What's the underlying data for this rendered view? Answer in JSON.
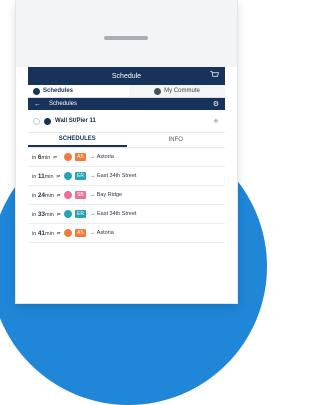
{
  "header": {
    "title": "Schedule"
  },
  "segments": [
    {
      "label": "Schedules"
    },
    {
      "label": "My Commute"
    }
  ],
  "subbar": {
    "title": "Schedules"
  },
  "stop": {
    "name": "Wall St/Pier 11"
  },
  "tabs": [
    {
      "label": "SCHEDULES"
    },
    {
      "label": "INFO"
    }
  ],
  "rows": [
    {
      "prefix": "in",
      "num": "6",
      "unit": "min",
      "route": "AS",
      "color": "#f37a3c",
      "dest": "Astoria"
    },
    {
      "prefix": "in",
      "num": "11",
      "unit": "min",
      "route": "ER",
      "color": "#27a2b7",
      "dest": "East 34th Street"
    },
    {
      "prefix": "in",
      "num": "24",
      "unit": "min",
      "route": "SB",
      "color": "#ec6e99",
      "dest": "Bay Ridge"
    },
    {
      "prefix": "in",
      "num": "33",
      "unit": "min",
      "route": "ER",
      "color": "#27a2b7",
      "dest": "East 34th Street"
    },
    {
      "prefix": "in",
      "num": "41",
      "unit": "min",
      "route": "AS",
      "color": "#f37a3c",
      "dest": "Astoria"
    }
  ],
  "colors": {
    "navy": "#17325b",
    "brand_blue": "#1f86d8"
  }
}
